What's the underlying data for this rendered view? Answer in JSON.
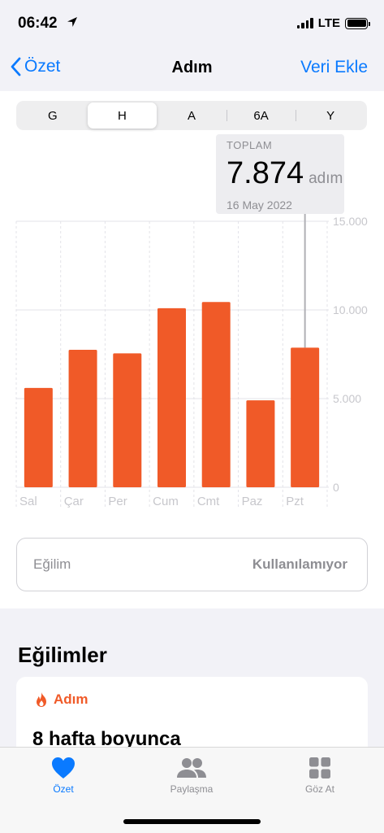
{
  "status_bar": {
    "time": "06:42",
    "network": "LTE"
  },
  "nav": {
    "back_label": "Özet",
    "title": "Adım",
    "action_label": "Veri Ekle"
  },
  "segments": [
    "G",
    "H",
    "A",
    "6A",
    "Y"
  ],
  "selected_segment": "H",
  "tooltip": {
    "label": "TOPLAM",
    "value": "7.874",
    "unit": "adım",
    "date": "16 May 2022"
  },
  "chart_data": {
    "type": "bar",
    "categories": [
      "Sal",
      "Çar",
      "Per",
      "Cum",
      "Cmt",
      "Paz",
      "Pzt"
    ],
    "values": [
      5600,
      7750,
      7550,
      10100,
      10450,
      4900,
      7874
    ],
    "y_ticks": [
      "15.000",
      "10.000",
      "5.000",
      "0"
    ],
    "y_tick_values": [
      15000,
      10000,
      5000,
      0
    ],
    "ylim": [
      0,
      15000
    ],
    "bar_color": "#f05a28",
    "highlighted_index": 6
  },
  "trend_box": {
    "label": "Eğilim",
    "value": "Kullanılamıyor"
  },
  "trends_section": {
    "title": "Eğilimler",
    "card_title": "Adım",
    "card_body": "8 hafta boyunca"
  },
  "tabbar": [
    {
      "label": "Özet",
      "icon": "heart-icon",
      "active": true
    },
    {
      "label": "Paylaşma",
      "icon": "people-icon",
      "active": false
    },
    {
      "label": "Göz At",
      "icon": "grid-icon",
      "active": false
    }
  ],
  "colors": {
    "accent": "#0a7aff",
    "bar": "#f05a28",
    "muted": "#8e8e93"
  }
}
